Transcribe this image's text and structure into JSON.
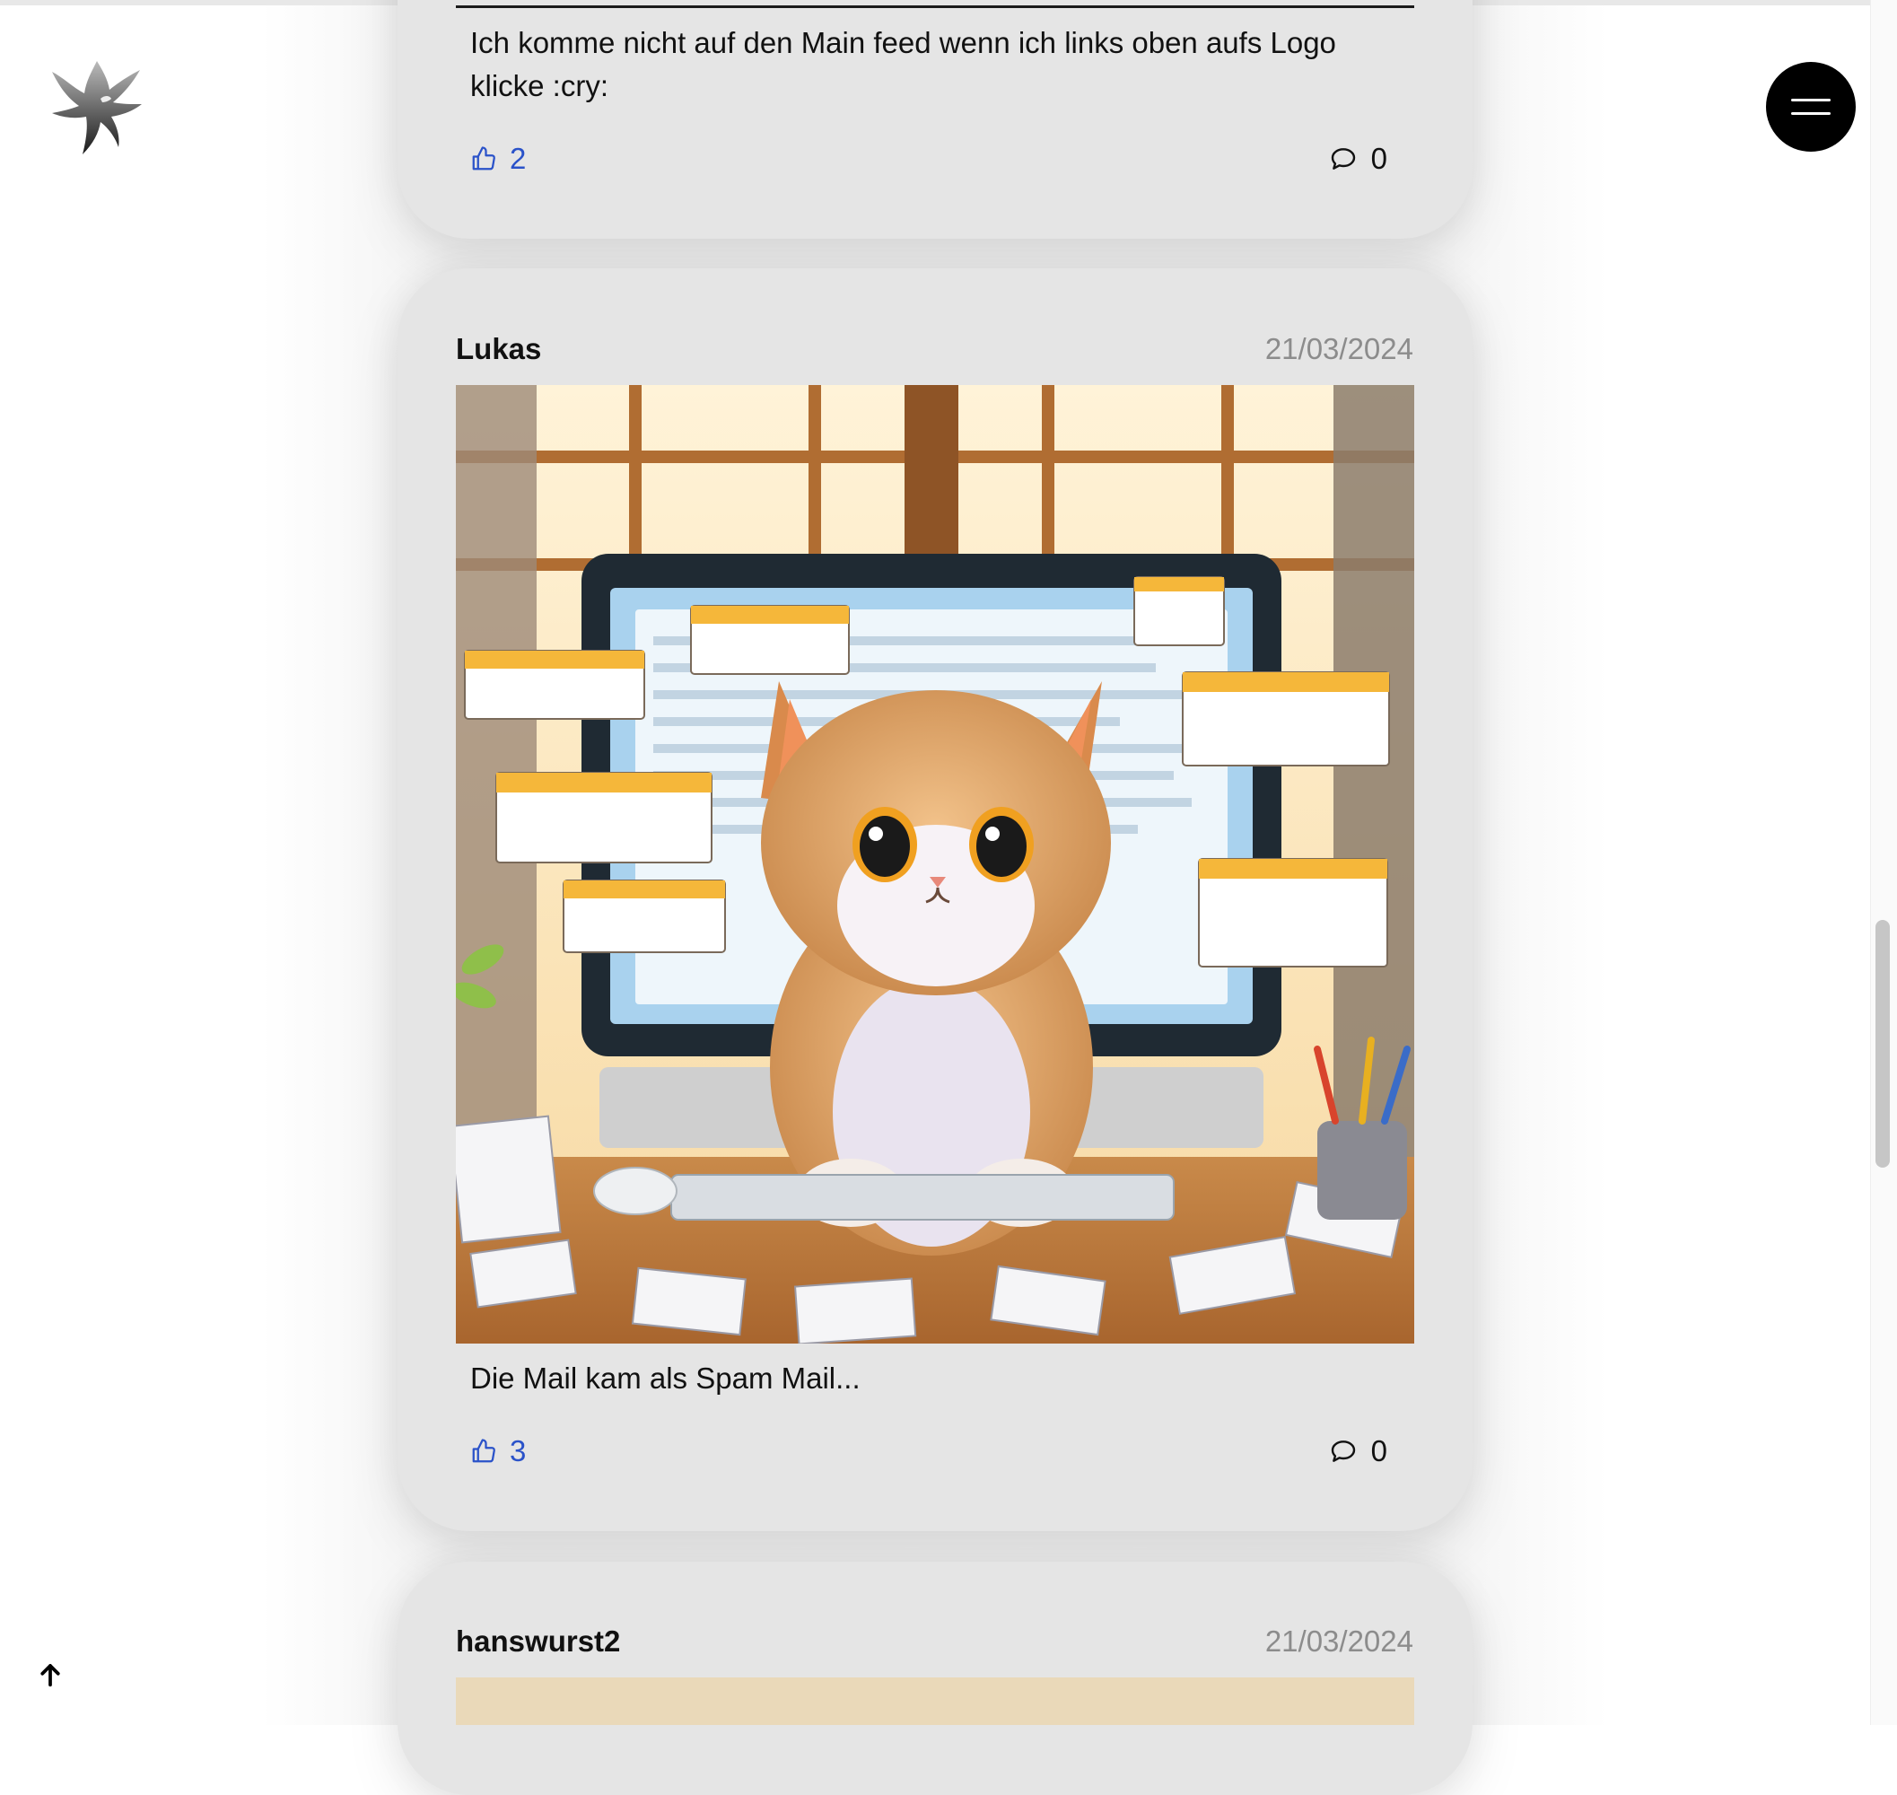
{
  "header": {
    "logo_icon": "eagle-logo-icon",
    "menu_icon": "hamburger-menu-icon"
  },
  "posts": [
    {
      "text": "Ich komme nicht auf den Main feed wenn ich links oben aufs Logo klicke :cry:",
      "likes": "2",
      "comments": "0"
    },
    {
      "author": "Lukas",
      "date": "21/03/2024",
      "image": "cartoon-cat-at-computer-with-spam-mails",
      "text": "Die Mail kam als Spam Mail...",
      "likes": "3",
      "comments": "0"
    },
    {
      "author": "hanswurst2",
      "date": "21/03/2024"
    }
  ],
  "colors": {
    "accent": "#2a52c9",
    "card_bg": "#e5e5e5",
    "menu_button": "#000000",
    "date_text": "#8c8c8c"
  }
}
